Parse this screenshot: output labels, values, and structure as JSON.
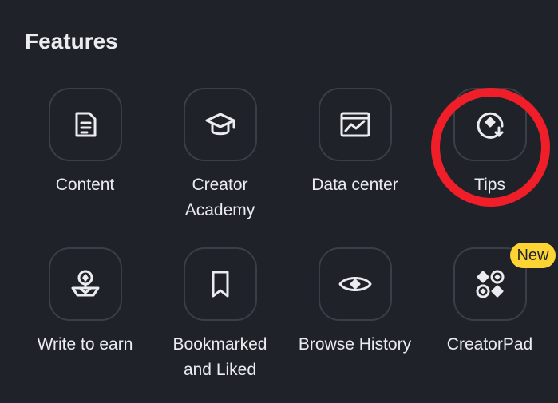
{
  "section": {
    "title": "Features"
  },
  "features": [
    {
      "label": "Content",
      "icon": "document-icon"
    },
    {
      "label": "Creator\nAcademy",
      "icon": "graduation-cap-icon"
    },
    {
      "label": "Data center",
      "icon": "chart-window-icon"
    },
    {
      "label": "Tips",
      "icon": "tips-icon"
    },
    {
      "label": "Write to earn",
      "icon": "coin-hand-icon"
    },
    {
      "label": "Bookmarked\nand Liked",
      "icon": "bookmark-icon"
    },
    {
      "label": "Browse History",
      "icon": "eye-icon"
    },
    {
      "label": "CreatorPad",
      "icon": "creator-pad-icon",
      "badge": "New"
    }
  ],
  "colors": {
    "background": "#1f2329",
    "text": "#eaecef",
    "icon_border": "#3a3f47",
    "badge": "#fcd535",
    "highlight_ring": "#f01e28"
  }
}
